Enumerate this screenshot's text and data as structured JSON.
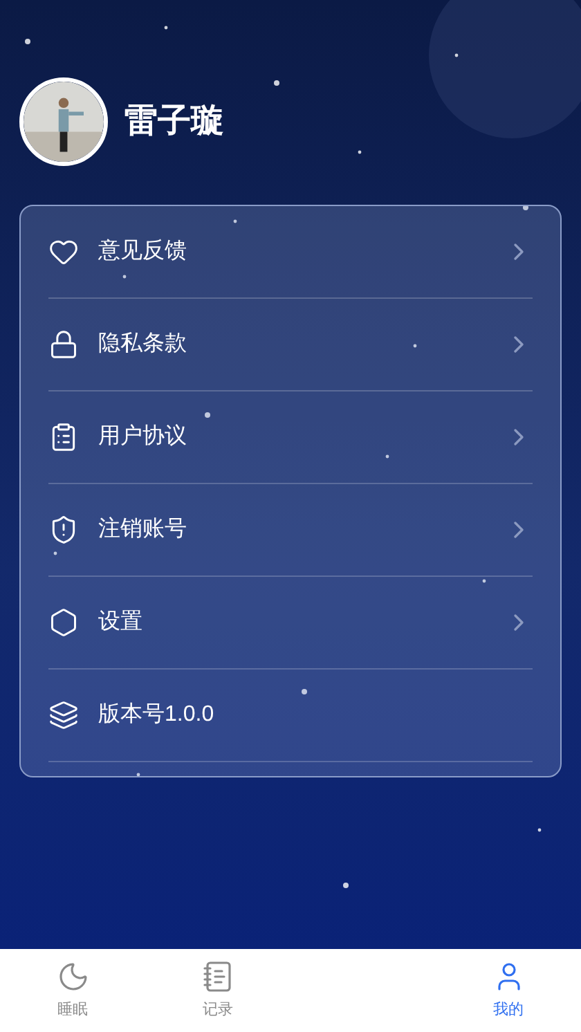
{
  "profile": {
    "name": "雷子璇"
  },
  "menu": [
    {
      "label": "意见反馈"
    },
    {
      "label": "隐私条款"
    },
    {
      "label": "用户协议"
    },
    {
      "label": "注销账号"
    },
    {
      "label": "设置"
    },
    {
      "label": "版本号1.0.0"
    }
  ],
  "tab_bar": [
    {
      "label": "睡眠",
      "selected": false
    },
    {
      "label": "记录",
      "selected": false
    },
    {
      "label": "我的",
      "selected": true
    }
  ]
}
